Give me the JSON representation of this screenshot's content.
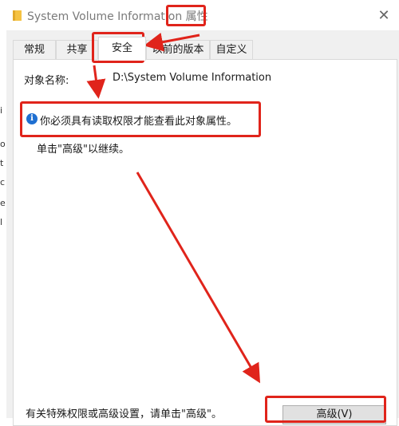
{
  "window": {
    "title_prefix": "System Volume Information",
    "title_suffix": "属性"
  },
  "tabs": [
    {
      "label": "常规"
    },
    {
      "label": "共享"
    },
    {
      "label": "安全"
    },
    {
      "label": "以前的版本"
    },
    {
      "label": "自定义"
    }
  ],
  "active_tab": "安全",
  "security": {
    "object_label": "对象名称:",
    "object_value": "D:\\System Volume Information",
    "info_message": "你必须具有读取权限才能查看此对象属性。",
    "continue_message": "单击\"高级\"以继续。",
    "special_permissions_text": "有关特殊权限或高级设置，请单击\"高级\"。",
    "advanced_button": "高级(V)"
  },
  "icons": {
    "folder": "folder-icon",
    "close": "close-icon",
    "info": "info-icon"
  },
  "colors": {
    "annotation": "#e0241b",
    "info_blue": "#1e6fd1",
    "folder_yellow": "#f5c242"
  }
}
